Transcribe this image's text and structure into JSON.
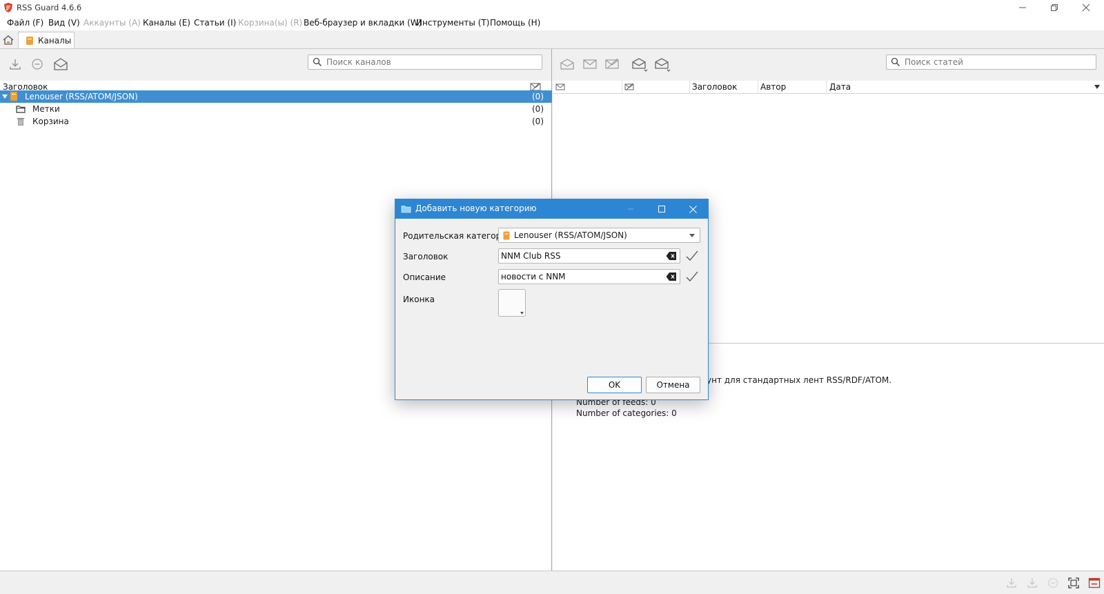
{
  "window": {
    "title": "RSS Guard 4.6.6"
  },
  "menu": [
    {
      "label": "Файл (F)",
      "enabled": true
    },
    {
      "label": "Вид (V)",
      "enabled": true
    },
    {
      "label": "Аккаунты (A)",
      "enabled": false
    },
    {
      "label": "Каналы (E)",
      "enabled": true
    },
    {
      "label": "Статьи (I)",
      "enabled": true
    },
    {
      "label": "Корзина(ы) (R)",
      "enabled": false
    },
    {
      "label": "Веб-браузер и вкладки (W)",
      "enabled": true
    },
    {
      "label": "Инструменты (T)",
      "enabled": true
    },
    {
      "label": "Помощь (H)",
      "enabled": true
    }
  ],
  "tabs": {
    "feeds": "Каналы"
  },
  "feeds_pane": {
    "search_placeholder": "Поиск каналов",
    "column_title": "Заголовок",
    "items": [
      {
        "label": "Lenouser (RSS/ATOM/JSON)",
        "count": "(0)",
        "icon": "account-icon",
        "selected": true
      },
      {
        "label": "Метки",
        "count": "(0)",
        "icon": "labels-icon",
        "selected": false
      },
      {
        "label": "Корзина",
        "count": "(0)",
        "icon": "trash-icon",
        "selected": false
      }
    ]
  },
  "articles_pane": {
    "search_placeholder": "Поиск статей",
    "columns": {
      "title": "Заголовок",
      "author": "Автор",
      "date": "Дата"
    }
  },
  "info": {
    "line1": "унт для стандартных лент RSS/RDF/ATOM.",
    "line2": "Number of feeds: 0",
    "line3": "Number of categories: 0"
  },
  "dialog": {
    "title": "Добавить новую категорию",
    "parent_label": "Родительская категория",
    "parent_value": "Lenouser (RSS/ATOM/JSON)",
    "title_label": "Заголовок",
    "title_value": "NNM Club RSS",
    "description_label": "Описание",
    "description_value": "новости с NNM",
    "icon_label": "Иконка",
    "ok": "OK",
    "cancel": "Отмена"
  },
  "colors": {
    "accent": "#2d86d3",
    "selection": "#3f8fd2"
  }
}
